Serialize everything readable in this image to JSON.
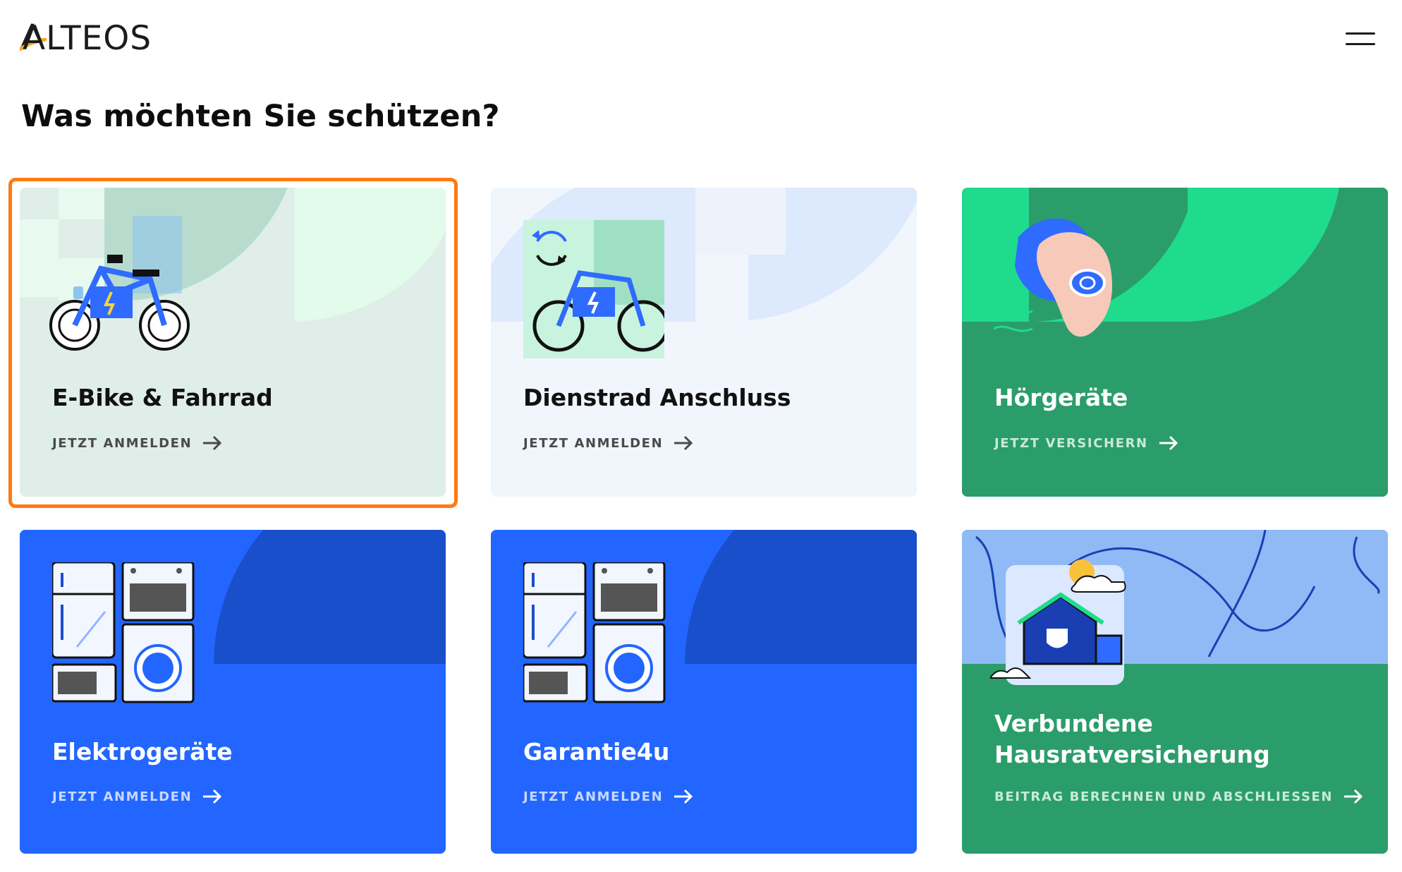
{
  "brand": {
    "name": "ALTEOS",
    "logo_accent_color": "#f7a823"
  },
  "header": {
    "menu_icon": "hamburger-menu-icon"
  },
  "page": {
    "title": "Was möchten Sie schützen?"
  },
  "focus": {
    "selected_card": "E-Bike & Fahrrad",
    "ring_color": "#ff7a12"
  },
  "cards": [
    {
      "title": "E-Bike & Fahrrad",
      "cta": "JETZT ANMELDEN",
      "icon": "e-bike-icon",
      "bg": "#dfeee8",
      "text_color": "#111111",
      "cta_color": "#4a4a4a"
    },
    {
      "title": "Dienstrad Anschluss",
      "cta": "JETZT ANMELDEN",
      "icon": "bike-swap-icon",
      "bg": "#f1f6fd",
      "text_color": "#111111",
      "cta_color": "#4a4a4a"
    },
    {
      "title": "Hörgeräte",
      "cta": "JETZT VERSICHERN",
      "icon": "ear-hearing-aid-icon",
      "bg": "#2b9d6a",
      "text_color": "#ffffff",
      "cta_color": "#c8ead9"
    },
    {
      "title": "Elektrogeräte",
      "cta": "JETZT ANMELDEN",
      "icon": "appliances-icon",
      "bg": "#2266ff",
      "text_color": "#ffffff",
      "cta_color": "#c9d8ff"
    },
    {
      "title": "Garantie4u",
      "cta": "JETZT ANMELDEN",
      "icon": "appliances-icon",
      "bg": "#2266ff",
      "text_color": "#ffffff",
      "cta_color": "#c9d8ff"
    },
    {
      "title_line1": "Verbundene",
      "title_line2": "Hausratversicherung",
      "cta": "BEITRAG BERECHNEN UND ABSCHLIESSEN",
      "icon": "house-icon",
      "bg": "#2b9d6a",
      "text_color": "#ffffff",
      "cta_color": "#c8ead9"
    }
  ]
}
